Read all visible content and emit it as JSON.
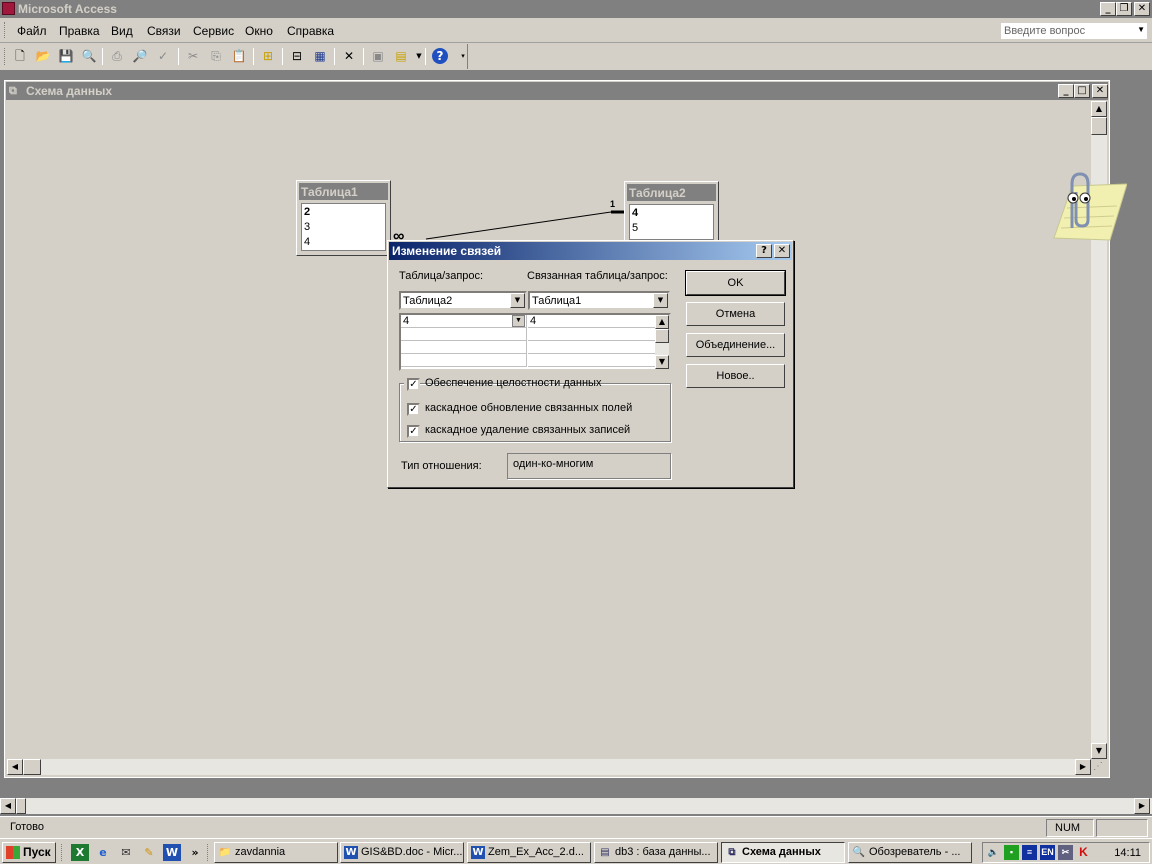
{
  "app": {
    "title": "Microsoft Access"
  },
  "menu": [
    "Файл",
    "Правка",
    "Вид",
    "Связи",
    "Сервис",
    "Окно",
    "Справка"
  ],
  "help_box": {
    "placeholder": "Введите вопрос"
  },
  "child_window": {
    "title": "Схема данных"
  },
  "tables": [
    {
      "name": "Таблица1",
      "fields": [
        "2",
        "3",
        "4"
      ]
    },
    {
      "name": "Таблица2",
      "fields": [
        "4",
        "5"
      ]
    }
  ],
  "relationship": {
    "one_label": "1",
    "many_label": "∞"
  },
  "dialog": {
    "title": "Изменение связей",
    "help_btn": "?",
    "table_label": "Таблица/запрос:",
    "related_label": "Связанная таблица/запрос:",
    "table_value": "Таблица2",
    "related_value": "Таблица1",
    "field_rows": [
      {
        "left": "4",
        "right": "4"
      },
      {
        "left": "",
        "right": ""
      },
      {
        "left": "",
        "right": ""
      },
      {
        "left": "",
        "right": ""
      }
    ],
    "buttons": {
      "ok": "OK",
      "cancel": "Отмена",
      "join": "Объединение...",
      "new": "Новое.."
    },
    "integrity": {
      "label": "Обеспечение целостности данных",
      "checked": true
    },
    "cascade_update": {
      "label": "каскадное обновление связанных полей",
      "checked": true
    },
    "cascade_delete": {
      "label": "каскадное удаление связанных записей",
      "checked": true
    },
    "rel_type_label": "Тип отношения:",
    "rel_type_value": "один-ко-многим"
  },
  "status": {
    "text": "Готово",
    "num": "NUM"
  },
  "taskbar": {
    "start": "Пуск",
    "tasks": [
      "zavdannia",
      "GIS&BD.doc - Micr...",
      "Zem_Ex_Acc_2.d...",
      "db3 : база данны...",
      "Схема данных",
      "Обозреватель - ..."
    ],
    "tray_lang": "EN",
    "clock": "14:11"
  }
}
